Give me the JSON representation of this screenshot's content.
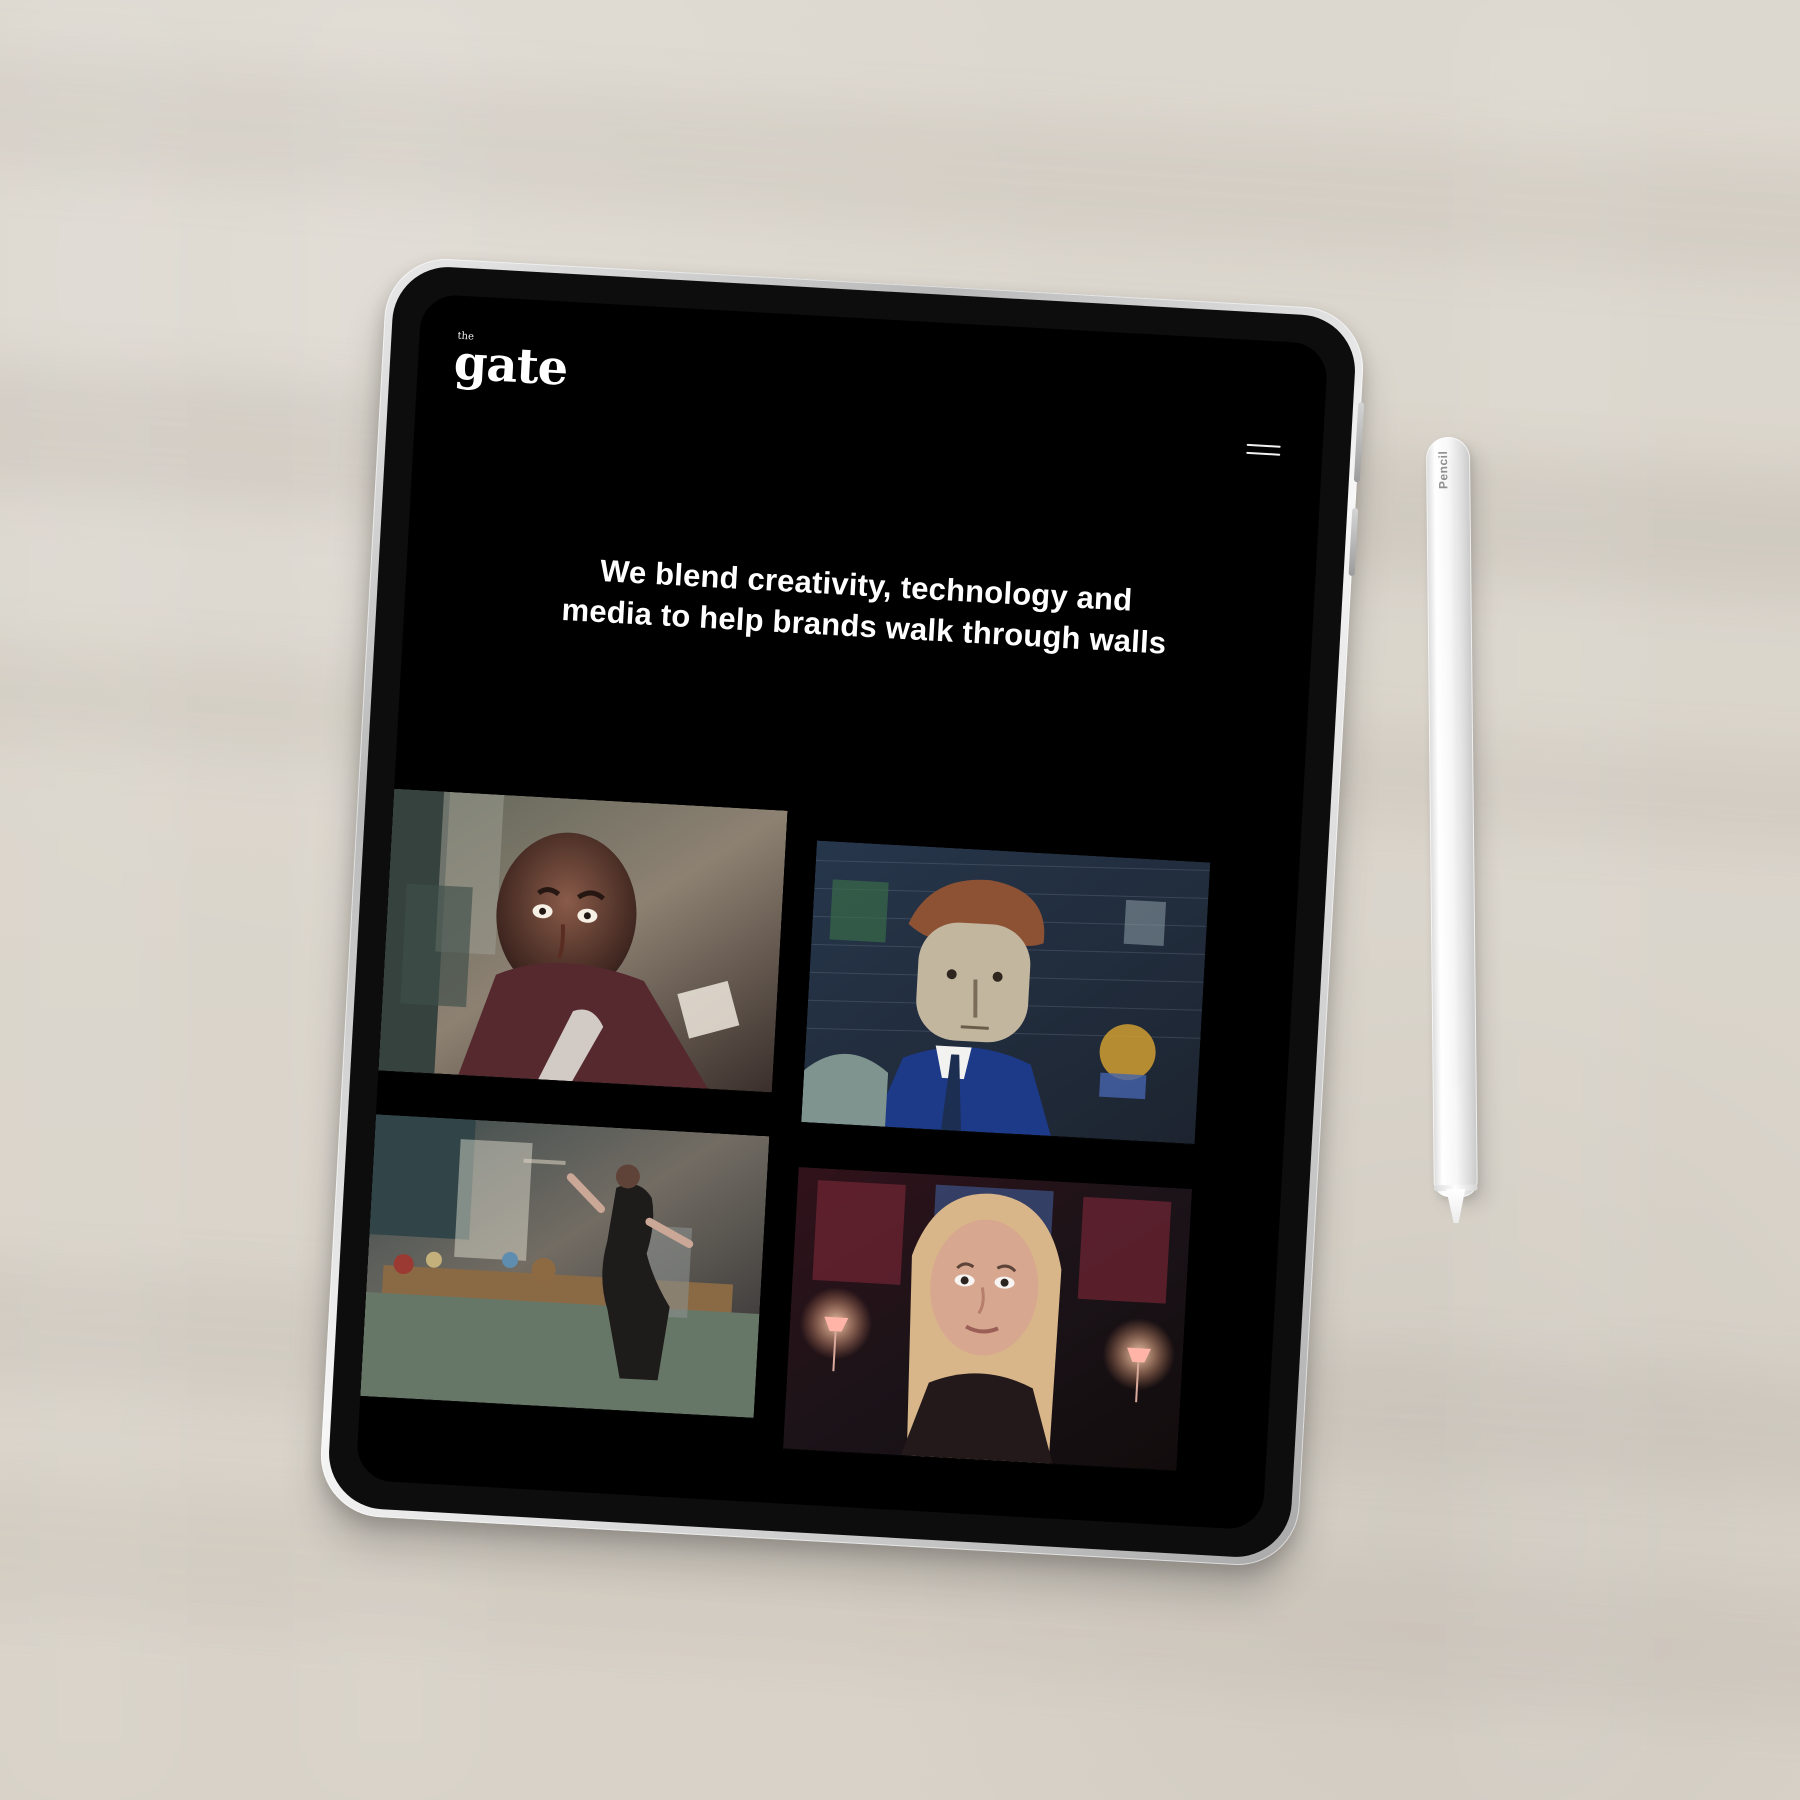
{
  "brand": {
    "small_label": "the",
    "name": "gate"
  },
  "hero": {
    "line1": "We blend creativity, technology and",
    "line2": "media to help brands walk through walls"
  },
  "accessory": {
    "pencil_label": "Pencil",
    "pencil_brand_icon": "apple-icon"
  },
  "icons": {
    "menu": "hamburger-menu-icon"
  },
  "colors": {
    "background": "#d9d4ca",
    "screen": "#000000",
    "text": "#ffffff"
  }
}
